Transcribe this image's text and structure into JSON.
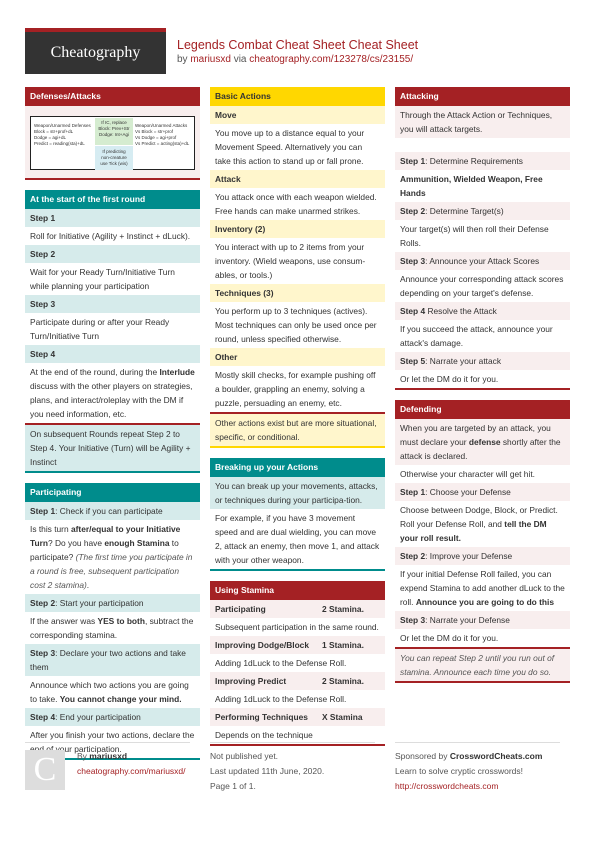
{
  "header": {
    "logo": "Cheatography",
    "title": "Legends Combat Cheat Sheet Cheat Sheet",
    "by": "by",
    "author": "mariusxd",
    "via": "via",
    "url": "cheatography.com/123278/cs/23155/"
  },
  "defenses_attacks": {
    "title": "Defenses/Attacks",
    "image": {
      "left_title": "Weapon/Unarmed Defenses",
      "left_lines": [
        "Block = str+prof+dL",
        "Dodge = agi+dL",
        "Predict = reading(sta)+dL"
      ],
      "green_lines": [
        "If IC, replace",
        "Block: Prev+Str",
        "Dodge: Int+Agi"
      ],
      "blue_lines": [
        "If predicting",
        "non-creature",
        "use Tick (wis)"
      ],
      "right_title": "Weapon/Unarmed Attacks",
      "right_lines": [
        "Vs Block = str+prof",
        "Vs Dodge = agi+prof",
        "Vs Predict = acting(sta)+dL"
      ]
    }
  },
  "first_round": {
    "title": "At the start of the first round",
    "steps": [
      {
        "head": "Step 1",
        "body": "Roll for Initiative (Agility + Instinct + dLuck)."
      },
      {
        "head": "Step 2",
        "body": "Wait for your Ready Turn/Initiative Turn while planning your participation"
      },
      {
        "head": "Step 3",
        "body": "Participate during or after your Ready Turn/Initiative Turn"
      },
      {
        "head": "Step 4",
        "body_pre": "At the end of the round, during the ",
        "body_bold": "Interlude",
        "body_post": " discuss with the other players on strategies, plans, and interact/roleplay with the DM if you need information, etc."
      }
    ],
    "note": "On subsequent Rounds repeat Step 2 to Step 4. Your Initiative (Turn) will be Agility + Instinct"
  },
  "participating": {
    "title": "Participating",
    "step1_head": "Step 1",
    "step1_text": ": Check if you can participate",
    "step1_body": {
      "a": "Is this turn ",
      "b": "after/equal to your Initiative Turn",
      "c": "? Do you have ",
      "d": "enough Stamina",
      "e": " to participate? ",
      "f": "(The first time you participate in a round is free, subsequent participation cost 2 stamina)",
      "g": "."
    },
    "step2_head": "Step 2",
    "step2_text": ": Start your participation",
    "step2_body": {
      "a": "If the answer was ",
      "b": "YES to both",
      "c": ", subtract the corresponding stamina."
    },
    "step3_head": "Step 3",
    "step3_text": ": Declare your two actions and take them",
    "step3_body": {
      "a": "Announce which two actions you are going to take. ",
      "b": "You cannot change your mind."
    },
    "step4_head": "Step 4",
    "step4_text": ": End your participation",
    "step4_body": "After you finish your two actions, declare the end of your participation."
  },
  "basic_actions": {
    "title": "Basic Actions",
    "items": [
      {
        "head": "Move",
        "body": "You move up to a distance equal to your Movement Speed. Alternatively you can take this action to stand up or fall prone."
      },
      {
        "head": "Attack",
        "body": "You attack once with each weapon wielded. Free hands can make unarmed strikes."
      },
      {
        "head": "Inventory (2)",
        "body": "You interact with up to 2 items from your inventory. (Wield weapons, use consum-ables, or tools.)"
      },
      {
        "head": "Techniques (3)",
        "body": "You perform up to 3 techniques (actives). Most techniques can only be used once per round, unless specified otherwise."
      },
      {
        "head": "Other",
        "body": "Mostly skill checks, for example pushing off a boulder, grappling an enemy, solving a puzzle, persuading an enemy, etc."
      }
    ],
    "note": "Other actions exist but are more situational, specific, or conditional."
  },
  "breaking_up": {
    "title": "Breaking up your Actions",
    "row1": "You can break up your movements, attacks, or techniques during your participa-tion.",
    "row2": "For example, if you have 3 movement speed and are dual wielding, you can move 2, attack an enemy, then move 1, and attack with your other weapon."
  },
  "using_stamina": {
    "title": "Using Stamina",
    "items": [
      {
        "name": "Participating",
        "cost": "2 Stamina.",
        "desc": "Subsequent participation in the same round."
      },
      {
        "name": "Improving Dodge/Block",
        "cost": "1 Stamina.",
        "desc": "Adding 1dLuck to the Defense Roll."
      },
      {
        "name": "Improving Predict",
        "cost": "2 Stamina.",
        "desc": "Adding 1dLuck to the Defense Roll."
      },
      {
        "name": "Performing Techniques",
        "cost": "X Stamina",
        "desc": "Depends on the technique"
      }
    ]
  },
  "attacking": {
    "title": "Attacking",
    "intro": "Through the Attack Action or Techniques, you will attack targets.",
    "step1_head": "Step 1",
    "step1_text": ": Determine Requirements",
    "step1_body": "Ammunition, Wielded Weapon, Free Hands",
    "step2_head": "Step 2",
    "step2_text": ": Determine Target(s)",
    "step2_body": "Your target(s) will then roll their Defense Rolls.",
    "step3_head": "Step 3",
    "step3_text": ": Announce your Attack Scores",
    "step3_body": "Announce your corresponding attack scores depending on your target's defense.",
    "step4_head": "Step 4",
    "step4_text": " Resolve the Attack",
    "step4_body": "If you succeed the attack, announce your attack's damage.",
    "step5_head": "Step 5",
    "step5_text": ": Narrate your attack",
    "step5_body": "Or let the DM do it for you."
  },
  "defending": {
    "title": "Defending",
    "intro": {
      "a": "When you are targeted by an attack, you must declare your ",
      "b": "defense",
      "c": " shortly after the attack is declared."
    },
    "otherwise": "Otherwise your character will get hit.",
    "step1_head": "Step 1",
    "step1_text": ": Choose your Defense",
    "step1_body": {
      "a": "Choose between Dodge, Block, or Predict. Roll your Defense Roll, and ",
      "b": "tell the DM your roll result."
    },
    "step2_head": "Step 2",
    "step2_text": ": Improve your Defense",
    "step2_body": {
      "a": "If your initial Defense Roll failed, you can expend Stamina to add another dLuck to the roll. ",
      "b": "Announce you are going to do this"
    },
    "step3_head": "Step 3",
    "step3_text": ": Narrate your Defense",
    "step3_body": "Or let the DM do it for you.",
    "note": "You can repeat Step 2 until you run out of stamina. Announce each time you do so."
  },
  "footer": {
    "avatar_letter": "C",
    "by": "By ",
    "author": "mariusxd",
    "author_url": "cheatography.com/mariusxd/",
    "published": "Not published yet.",
    "updated": "Last updated 11th June, 2020.",
    "page": "Page 1 of 1.",
    "sponsored_by": "Sponsored by ",
    "sponsor": "CrosswordCheats.com",
    "sponsor_tagline": "Learn to solve cryptic crosswords!",
    "sponsor_url": "http://crosswordcheats.com"
  }
}
